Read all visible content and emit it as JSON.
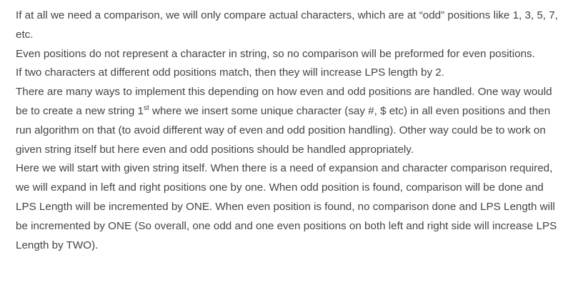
{
  "paragraphs": {
    "p1": {
      "text": "If at all we need a comparison, we will only compare actual characters, which are at “odd” positions like 1, 3, 5, 7, etc."
    },
    "p2": {
      "text": "Even positions do not represent a character in string, so no comparison will be preformed for even positions."
    },
    "p3": {
      "text": "If two characters at different odd positions match, then they will increase LPS length by 2."
    },
    "p4": {
      "before": "There are many ways to implement this depending on how even and odd positions are handled. One way would be to create a new string 1",
      "sup": "st",
      "after": " where we insert some unique character (say #, $ etc) in all even positions and then run algorithm on that (to avoid different way of even and odd position handling). Other way could be to work on given string itself but here even and odd positions should be handled appropriately."
    },
    "p5": {
      "text": "Here we will start with given string itself. When there is a need of expansion and character comparison required, we will expand in left and right positions one by one. When odd position is found, comparison will be done and LPS Length will be incremented by ONE. When even position is found, no comparison done and LPS Length will be incremented by ONE (So overall, one odd and one even positions on both left and right side will increase LPS Length by TWO)."
    }
  }
}
